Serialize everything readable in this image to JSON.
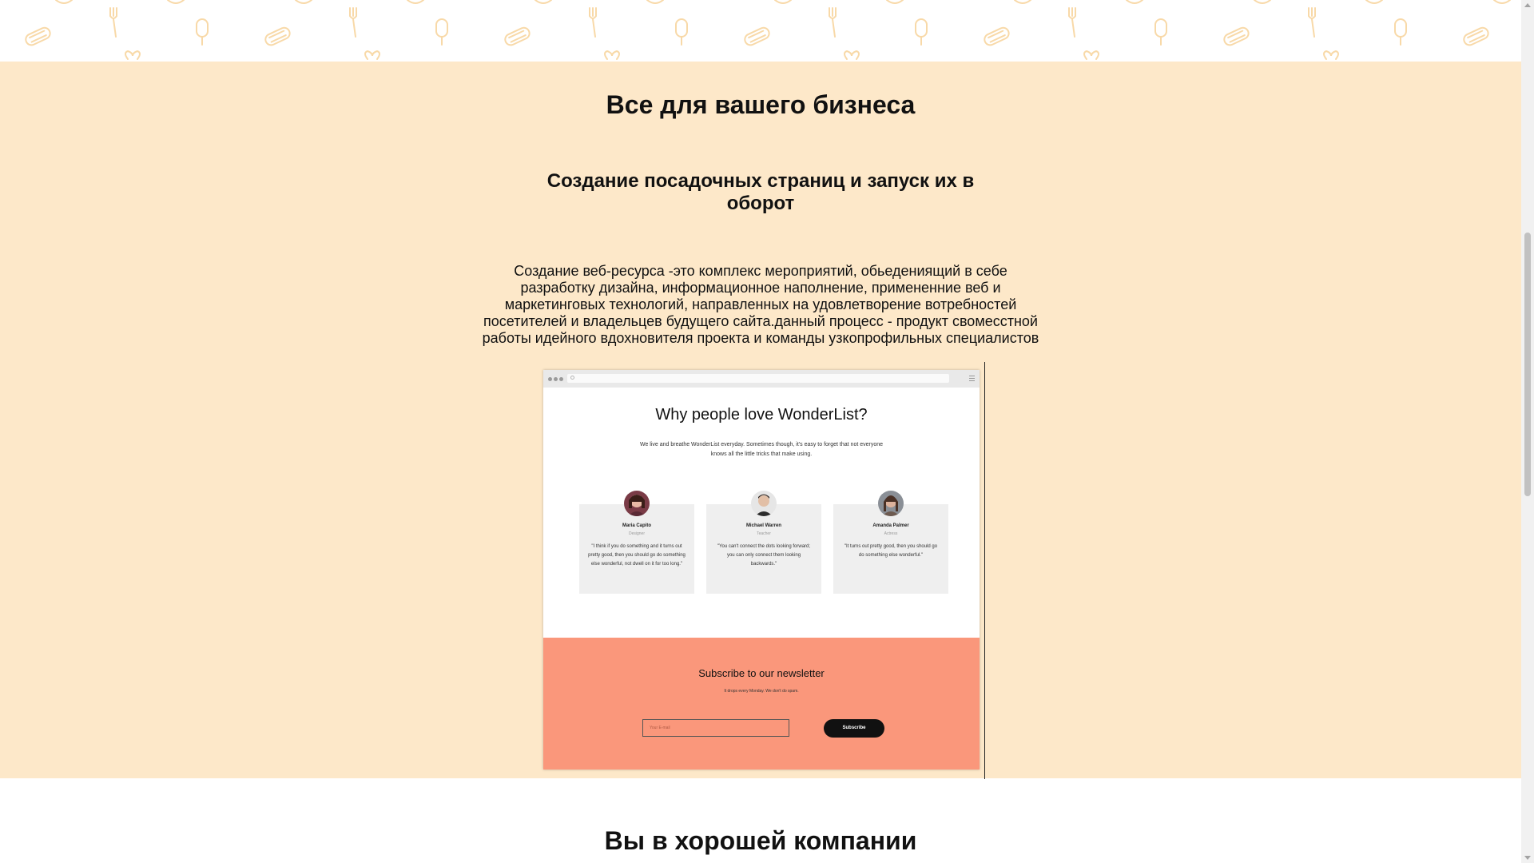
{
  "section": {
    "heading": "Все для вашего бизнеса",
    "subheading": "Создание посадочных страниц и запуск их в оборот",
    "description": "Создание веб-ресурса -это комплекс мероприятий, обьедениящий в себе разработку дизайна, информационное наполнение, примененние веб и маркетинговых технологий, направленных на удовлетворение вотребностей посетителей и владельцев будущего сайта.данный процесс - продукт свомесстной работы идейного вдохновителя проекта и команды узкопрофильных специалистов"
  },
  "mockup": {
    "title": "Why people love WonderList?",
    "subtitle": "We live and breathe WonderList everyday. Sometimes though, it's easy to forget that not everyone knows all the little tricks that make using.",
    "testimonials": [
      {
        "name": "Maria Capito",
        "role": "Designer",
        "quote": "\"I think if you do something and it turns out pretty good, then you should go do something else wonderful, not dwell on it for too long.\""
      },
      {
        "name": "Michael Warren",
        "role": "Teacher",
        "quote": "\"You can't connect the dots looking forward; you can only connect them looking backwards.\""
      },
      {
        "name": "Amanda Palmer",
        "role": "Actress",
        "quote": "\"It turns out pretty good, then you should go do something else wonderful.\""
      }
    ],
    "newsletter": {
      "title": "Subscribe to our newsletter",
      "note": "It drops every Monday. We don't do spam.",
      "email_placeholder": "Your E-mail",
      "button": "Subscribe"
    }
  },
  "next_section": {
    "heading": "Вы в хорошей компании"
  },
  "colors": {
    "cream": "#fde8c9",
    "salmon": "#fa977b",
    "pattern": "#f8d9a8"
  },
  "icons": [
    "fork-icon",
    "popsicle-icon",
    "hotdog-icon",
    "heart-icon",
    "circle-icon",
    "menu-icon"
  ]
}
